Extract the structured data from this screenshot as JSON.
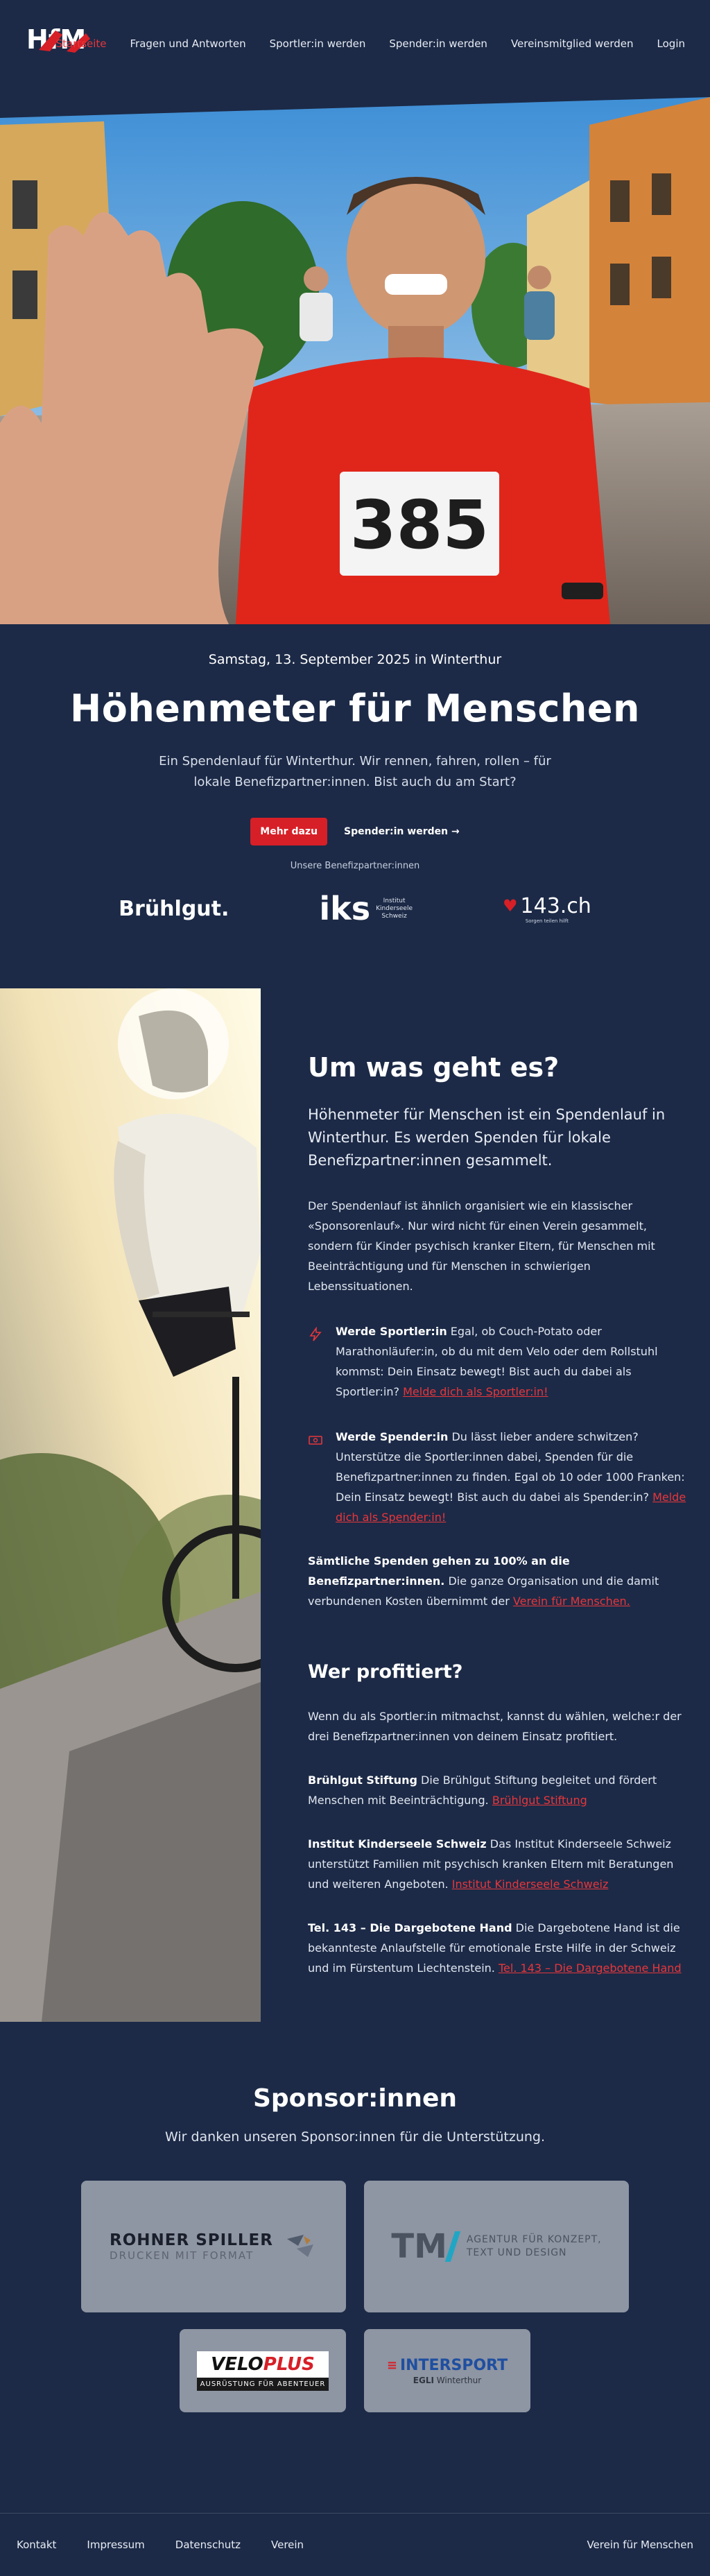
{
  "nav": {
    "logo_text": "HfM",
    "links": [
      "Startseite",
      "Fragen und Antworten",
      "Sportler:in werden",
      "Spender:in werden",
      "Vereinsmitglied werden",
      "Login"
    ]
  },
  "hero": {
    "bib_number": "385"
  },
  "event": {
    "date": "Samstag, 13. September 2025 in Winterthur",
    "title": "Höhenmeter für Menschen",
    "lead": "Ein Spendenlauf für Winterthur. Wir rennen, fahren, rollen – für lokale Benefizpartner:innen. Bist auch du am Start?",
    "primary_button": "Mehr dazu",
    "secondary_button": "Spender:in werden →",
    "partners_label": "Unsere Benefizpartner:innen",
    "partner_bruhl": "Brühlgut.",
    "partner_iks_mark": "iks",
    "partner_iks_line1": "Institut",
    "partner_iks_line2": "Kinderseele",
    "partner_iks_line3": "Schweiz",
    "partner_143": "143.ch",
    "partner_143_tag": "Sorgen teilen hilft"
  },
  "about": {
    "title": "Um was geht es?",
    "lead": "Höhenmeter für Menschen ist ein Spendenlauf in Winterthur. Es werden Spenden für lokale Benefizpartner:innen gesammelt.",
    "body": "Der Spendenlauf ist ähnlich organisiert wie ein klassischer «Sponsorenlauf». Nur wird nicht für einen Verein gesammelt, sondern für Kinder psychisch kranker Eltern, für Menschen mit Beeinträchtigung und für Menschen in schwierigen Lebenssituationen.",
    "feature1_title": "Werde Sportler:in",
    "feature1_text": " Egal, ob Couch-Potato oder Marathonläufer:in, ob du mit dem Velo oder dem Rollstuhl kommst: Dein Einsatz bewegt! Bist auch du dabei als Sportler:in? ",
    "feature1_link": "Melde dich als Sportler:in!",
    "feature2_title": "Werde Spender:in",
    "feature2_text": " Du lässt lieber andere schwitzen? Unterstütze die Sportler:innen dabei, Spenden für die Benefizpartner:innen zu finden. Egal ob 10 oder 1000 Franken: Dein Einsatz bewegt! Bist auch du dabei als Spender:in? ",
    "feature2_link": "Melde dich als Spender:in!",
    "note_bold": "Sämtliche Spenden gehen zu 100% an die Benefizpartner:innen.",
    "note_text": " Die ganze Organisation und die damit verbundenen Kosten übernimmt der ",
    "note_link": "Verein für Menschen."
  },
  "beneficiaries": {
    "title": "Wer profitiert?",
    "intro": "Wenn du als Sportler:in mitmachst, kannst du wählen, welche:r der drei Benefizpartner:innen von deinem Einsatz profitiert.",
    "items": [
      {
        "name": "Brühlgut Stiftung",
        "text": " Die Brühlgut Stiftung begleitet und fördert Menschen mit Beeinträchtigung. ",
        "link": "Brühlgut Stiftung"
      },
      {
        "name": "Institut Kinderseele Schweiz",
        "text": " Das Institut Kinderseele Schweiz unterstützt Familien mit psychisch kranken Eltern mit Beratungen und weiteren Angeboten. ",
        "link": "Institut Kinderseele Schweiz"
      },
      {
        "name": "Tel. 143 – Die Dargebotene Hand",
        "text": " Die Dargebotene Hand ist die bekannteste Anlaufstelle für emotionale Erste Hilfe in der Schweiz und im Fürstentum Liechtenstein. ",
        "link": "Tel. 143 – Die Dargebotene Hand"
      }
    ]
  },
  "sponsors": {
    "title": "Sponsor:innen",
    "subtitle": "Wir danken unseren Sponsor:innen für die Unterstützung.",
    "rohner_name": "ROHNER SPILLER",
    "rohner_tag": "DRUCKEN MIT FORMAT",
    "tm_mark": "TM",
    "tm_line1": "AGENTUR FÜR KONZEPT,",
    "tm_line2": "TEXT UND DESIGN",
    "velo_a": "VELO",
    "velo_b": "PLUS",
    "velo_tag": "AUSRÜSTUNG FÜR ABENTEUER",
    "intersport_name": "INTERSPORT",
    "intersport_tag_a": "EGLI",
    "intersport_tag_b": "Winterthur"
  },
  "footer": {
    "links": [
      "Kontakt",
      "Impressum",
      "Datenschutz",
      "Verein"
    ],
    "right": "Verein für Menschen"
  },
  "colors": {
    "background": "#1c2a47",
    "accent": "#d71f27",
    "link": "#e8363b"
  }
}
